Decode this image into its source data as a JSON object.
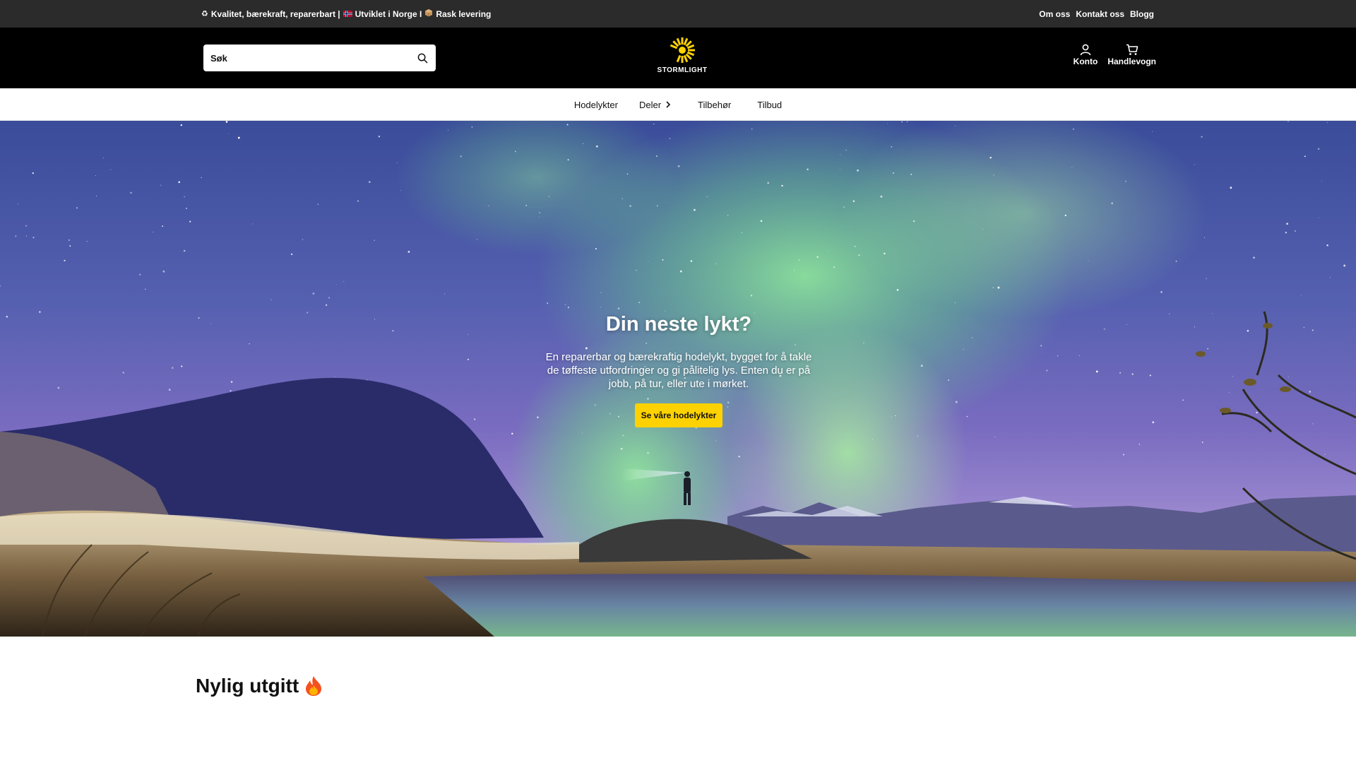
{
  "announcement": {
    "promo_icons": [
      "recycle-icon",
      "norway-flag-icon",
      "package-icon"
    ],
    "promo_part1": "Kvalitet, bærekraft, reparerbart |",
    "promo_part2": "Utviklet i Norge I",
    "promo_part3": "Rask levering",
    "links": [
      "Om oss",
      "Kontakt oss",
      "Blogg"
    ]
  },
  "header": {
    "search_placeholder": "Søk",
    "logo_text": "STORMLIGHT",
    "account_label": "Konto",
    "cart_label": "Handlevogn"
  },
  "nav": {
    "items": [
      "Hodelykter",
      "Deler",
      "Tilbehør",
      "Tilbud"
    ]
  },
  "hero": {
    "title": "Din neste lykt?",
    "text": "En reparerbar og bærekraftig hodelykt, bygget for å takle de tøffeste utfordringer og gi pålitelig lys. Enten du er på jobb, på tur, eller ute i mørket.",
    "button": "Se våre hodelykter"
  },
  "section": {
    "title": "Nylig utgitt",
    "title_icon": "fire-icon"
  },
  "colors": {
    "topbar": "#2b2b2b",
    "header": "#000000",
    "accent": "#fdd200"
  }
}
